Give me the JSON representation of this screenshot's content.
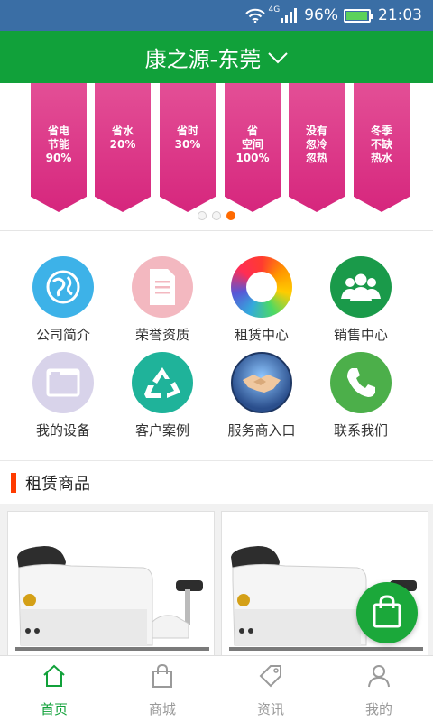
{
  "status_bar": {
    "network": "4G",
    "battery": "96%",
    "battery_level": 0.96,
    "time": "21:03"
  },
  "header": {
    "title": "康之源-东莞"
  },
  "banner": {
    "ribbons": [
      {
        "text": "省电\n节能\n90%"
      },
      {
        "text": "省水\n20%"
      },
      {
        "text": "省时\n30%"
      },
      {
        "text": "省\n空间\n100%"
      },
      {
        "text": "没有\n忽冷\n忽热"
      },
      {
        "text": "冬季\n不缺\n热水"
      }
    ],
    "active_slide": 3,
    "slide_count": 3
  },
  "grid": [
    {
      "label": "公司简介",
      "icon": "globe-icon",
      "color": "#3db2e8"
    },
    {
      "label": "荣誉资质",
      "icon": "document-icon",
      "color": "#f3b8c0"
    },
    {
      "label": "租赁中心",
      "icon": "rainbow-ring-icon",
      "color": "#ffffff"
    },
    {
      "label": "销售中心",
      "icon": "group-icon",
      "color": "#1a9a4a"
    },
    {
      "label": "我的设备",
      "icon": "window-icon",
      "color": "#d8d3ea"
    },
    {
      "label": "客户案例",
      "icon": "recycle-icon",
      "color": "#1fb39a"
    },
    {
      "label": "服务商入口",
      "icon": "handshake-icon",
      "color": "#2a4e8c"
    },
    {
      "label": "联系我们",
      "icon": "phone-icon",
      "color": "#4caf4a"
    }
  ],
  "section": {
    "title": "租赁商品"
  },
  "tabbar": {
    "items": [
      {
        "label": "首页",
        "icon": "home-icon",
        "active": true
      },
      {
        "label": "商城",
        "icon": "shopping-bag-icon",
        "active": false
      },
      {
        "label": "资讯",
        "icon": "tag-icon",
        "active": false
      },
      {
        "label": "我的",
        "icon": "user-icon",
        "active": false
      }
    ]
  },
  "colors": {
    "header": "#11a13a",
    "status_bar": "#3a6ea5",
    "accent": "#ff3b00",
    "ribbon": "#d6267d",
    "active_tab": "#11a13a"
  }
}
